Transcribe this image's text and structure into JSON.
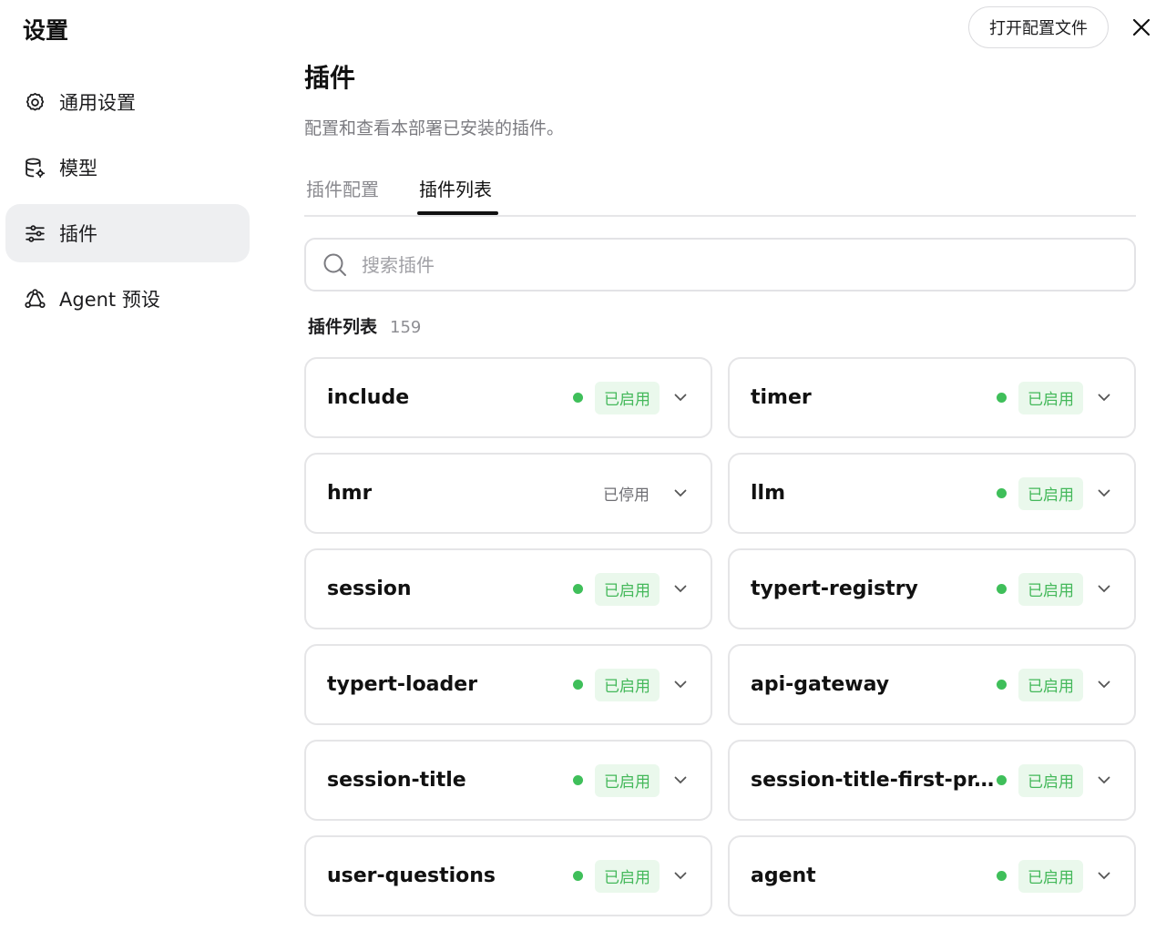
{
  "window": {
    "title": "设置"
  },
  "header": {
    "open_config_label": "打开配置文件"
  },
  "sidebar": {
    "items": [
      {
        "label": "通用设置",
        "icon": "gear-icon",
        "active": false
      },
      {
        "label": "模型",
        "icon": "database-gear-icon",
        "active": false
      },
      {
        "label": "插件",
        "icon": "sliders-icon",
        "active": true
      },
      {
        "label": "Agent 预设",
        "icon": "agent-nodes-icon",
        "active": false
      }
    ]
  },
  "main": {
    "title": "插件",
    "description": "配置和查看本部署已安装的插件。",
    "tabs": [
      {
        "label": "插件配置",
        "active": false
      },
      {
        "label": "插件列表",
        "active": true
      }
    ],
    "search": {
      "placeholder": "搜索插件",
      "value": ""
    },
    "list": {
      "title": "插件列表",
      "count": "159"
    }
  },
  "plugins": [
    {
      "name": "include",
      "status": "已启用",
      "enabled": true
    },
    {
      "name": "timer",
      "status": "已启用",
      "enabled": true
    },
    {
      "name": "hmr",
      "status": "已停用",
      "enabled": false
    },
    {
      "name": "llm",
      "status": "已启用",
      "enabled": true
    },
    {
      "name": "session",
      "status": "已启用",
      "enabled": true
    },
    {
      "name": "typert-registry",
      "status": "已启用",
      "enabled": true
    },
    {
      "name": "typert-loader",
      "status": "已启用",
      "enabled": true
    },
    {
      "name": "api-gateway",
      "status": "已启用",
      "enabled": true
    },
    {
      "name": "session-title",
      "status": "已启用",
      "enabled": true
    },
    {
      "name": "session-title-first-pr...",
      "status": "已启用",
      "enabled": true
    },
    {
      "name": "user-questions",
      "status": "已启用",
      "enabled": true
    },
    {
      "name": "agent",
      "status": "已启用",
      "enabled": true
    }
  ],
  "colors": {
    "enabled_green": "#3fbf5a",
    "enabled_badge_bg": "#eaf8ec",
    "active_nav_bg": "#eeeff1"
  }
}
